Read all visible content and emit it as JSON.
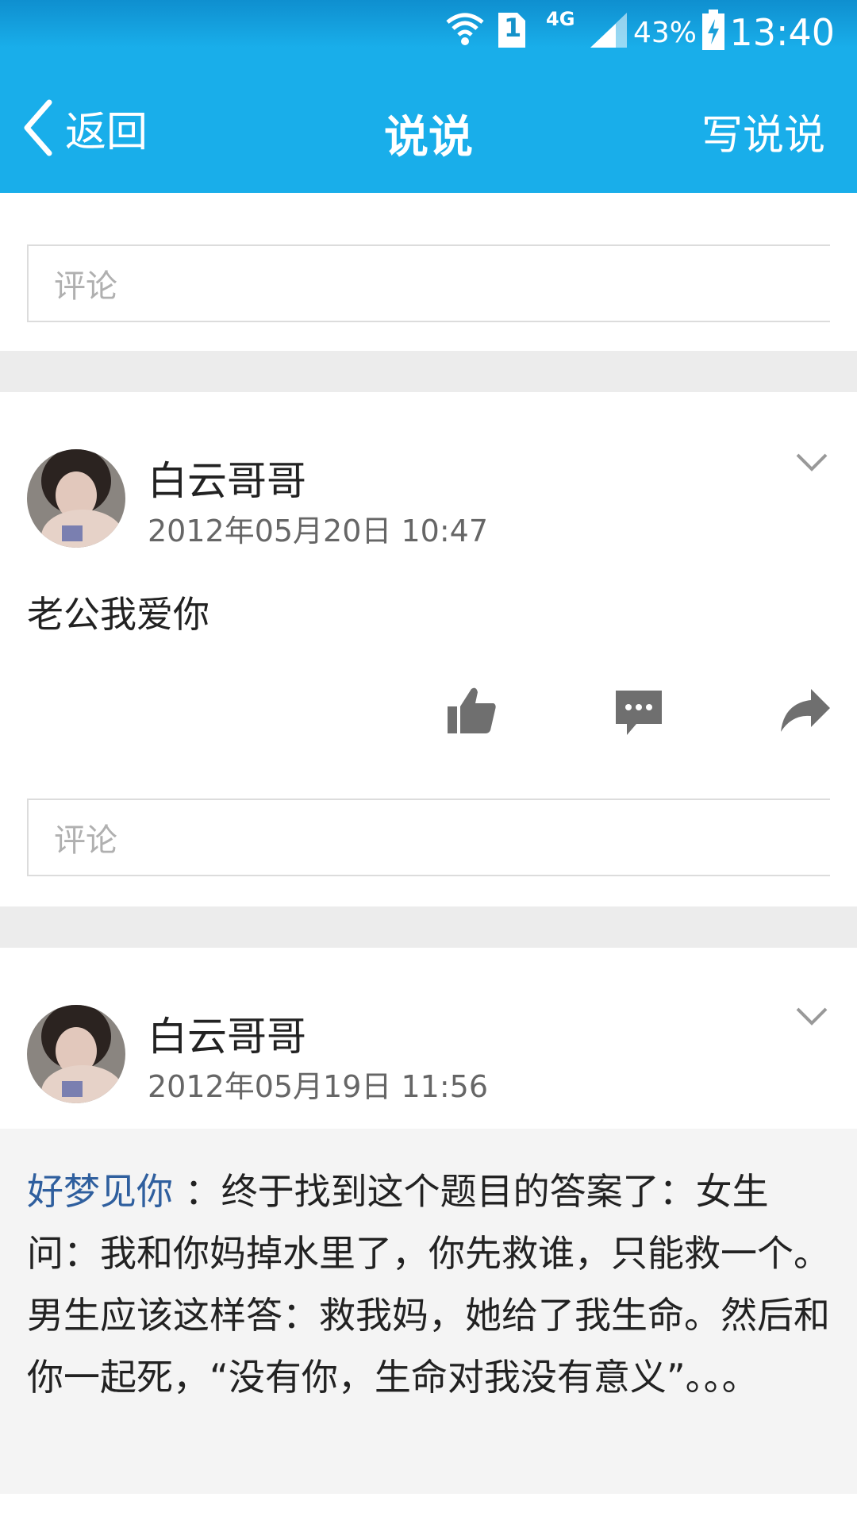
{
  "status_bar": {
    "network": "4G",
    "sim": "1",
    "battery": "43%",
    "time": "13:40"
  },
  "nav": {
    "back_label": "返回",
    "title": "说说",
    "write_label": "写说说"
  },
  "top_comment": {
    "placeholder": "评论"
  },
  "posts": [
    {
      "author": "白云哥哥",
      "time": "2012年05月20日 10:47",
      "text": "老公我爱你",
      "comment_placeholder": "评论"
    },
    {
      "author": "白云哥哥",
      "time": "2012年05月19日 11:56",
      "share_source": "好梦见你",
      "share_text": " ：终于找到这个题目的答案了：女生问：我和你妈掉水里了，你先救谁，只能救一个。男生应该这样答：救我妈，她给了我生命。然后和你一起死，“没有你，生命对我没有意义”。。。"
    }
  ],
  "colors": {
    "header": "#19aeea",
    "link": "#2f5f9e",
    "divider": "#ececec",
    "icon": "#6f6f6f"
  },
  "icons": [
    "wifi-icon",
    "sim-icon",
    "signal-icon",
    "battery-icon",
    "back-chevron-icon",
    "chevron-down-icon",
    "thumbs-up-icon",
    "comment-icon",
    "share-icon"
  ]
}
